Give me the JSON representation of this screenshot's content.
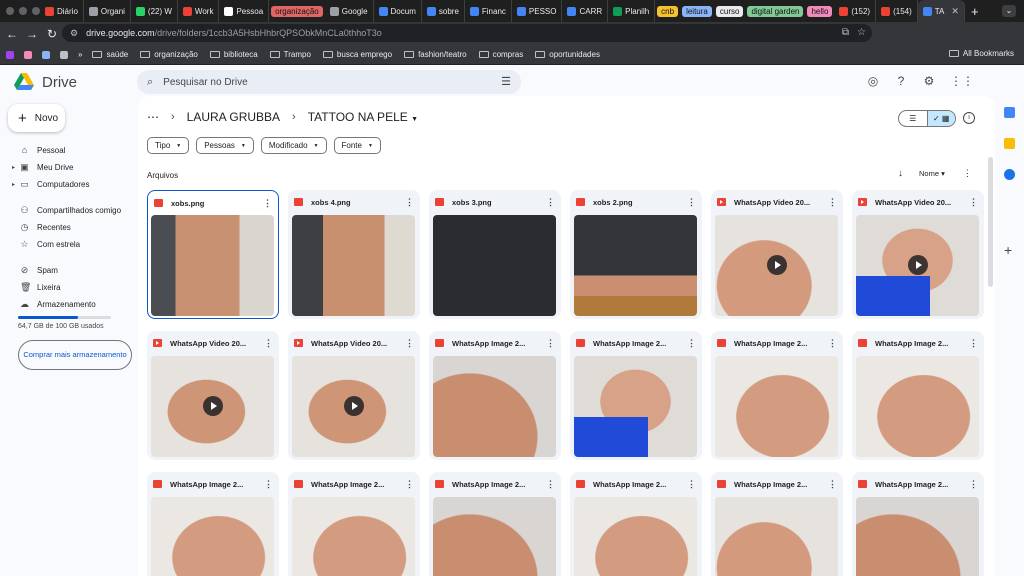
{
  "browser": {
    "tabs": [
      {
        "label": "Diário",
        "color": "#ea4335"
      },
      {
        "label": "Organi",
        "color": "#9aa0a6"
      },
      {
        "label": "(22) W",
        "color": "#25d366"
      },
      {
        "label": "Work",
        "color": "#ea4335"
      },
      {
        "label": "Pessoa",
        "color": "#ffffff"
      },
      {
        "label": "organização",
        "color": "#e06666",
        "pill": true
      },
      {
        "label": "Google",
        "color": "#9aa0a6"
      },
      {
        "label": "Docum",
        "color": "#4285f4"
      },
      {
        "label": "sobre",
        "color": "#4285f4"
      },
      {
        "label": "Financ",
        "color": "#4285f4"
      },
      {
        "label": "PESSO",
        "color": "#4285f4"
      },
      {
        "label": "CARR",
        "color": "#4285f4"
      },
      {
        "label": "Planilh",
        "color": "#0f9d58"
      },
      {
        "label": "cnb",
        "color": "#f4c430",
        "pill": true
      },
      {
        "label": "leitura",
        "color": "#8ab4f8",
        "pill": true
      },
      {
        "label": "curso",
        "color": "#e8eaed",
        "pill": true
      },
      {
        "label": "digital garden",
        "color": "#81c995",
        "pill": true
      },
      {
        "label": "hello",
        "color": "#f28bba",
        "pill": true
      },
      {
        "label": "(152)",
        "color": "#ea4335"
      },
      {
        "label": "(154)",
        "color": "#ea4335"
      },
      {
        "label": "TA",
        "color": "#4285f4",
        "active": true
      }
    ],
    "url_host": "drive.google.com",
    "url_path": "/drive/folders/1ccb3A5HsbHhbrQPSObkMnCLa0thhoT3o",
    "bookmarks": [
      "saúde",
      "organização",
      "biblioteca",
      "Trampo",
      "busca emprego",
      "fashion/teatro",
      "compras",
      "oportunidades"
    ],
    "all_bookmarks": "All Bookmarks"
  },
  "drive": {
    "app_name": "Drive",
    "search_placeholder": "Pesquisar no Drive",
    "new_label": "Novo",
    "nav": [
      {
        "label": "Pessoal",
        "icon": "home-icon"
      },
      {
        "label": "Meu Drive",
        "icon": "drive-icon",
        "caret": true
      },
      {
        "label": "Computadores",
        "icon": "computer-icon",
        "caret": true
      },
      {
        "label": "Compartilhados comigo",
        "icon": "people-icon"
      },
      {
        "label": "Recentes",
        "icon": "clock-icon"
      },
      {
        "label": "Com estrela",
        "icon": "star-icon"
      },
      {
        "label": "Spam",
        "icon": "spam-icon"
      },
      {
        "label": "Lixeira",
        "icon": "trash-icon"
      },
      {
        "label": "Armazenamento",
        "icon": "cloud-icon"
      }
    ],
    "storage_text": "64,7 GB de 100 GB usados",
    "storage_fraction": 0.647,
    "buy_storage": "Comprar mais armazenamento",
    "breadcrumb_parent": "LAURA GRUBBA",
    "breadcrumb_current": "TATTOO NA PELE",
    "filters": [
      "Tipo",
      "Pessoas",
      "Modificado",
      "Fonte"
    ],
    "section_label": "Arquivos",
    "sort_label": "Nome",
    "files": [
      {
        "name": "xobs.png",
        "kind": "image",
        "thumb": "t-leg1",
        "selected": true
      },
      {
        "name": "xobs 4.png",
        "kind": "image",
        "thumb": "t-leg2"
      },
      {
        "name": "xobs 3.png",
        "kind": "image",
        "thumb": "t-leg3"
      },
      {
        "name": "xobs 2.png",
        "kind": "image",
        "thumb": "t-leg4"
      },
      {
        "name": "WhatsApp Video 20...",
        "kind": "video",
        "thumb": "t-sh1"
      },
      {
        "name": "WhatsApp Video 20...",
        "kind": "video",
        "thumb": "t-shb",
        "strap": true
      },
      {
        "name": "WhatsApp Video 20...",
        "kind": "video",
        "thumb": "t-sh2"
      },
      {
        "name": "WhatsApp Video 20...",
        "kind": "video",
        "thumb": "t-sh2"
      },
      {
        "name": "WhatsApp Image 2...",
        "kind": "image",
        "thumb": "t-sh3"
      },
      {
        "name": "WhatsApp Image 2...",
        "kind": "image",
        "thumb": "t-shb",
        "strap": true
      },
      {
        "name": "WhatsApp Image 2...",
        "kind": "image",
        "thumb": "t-sh4"
      },
      {
        "name": "WhatsApp Image 2...",
        "kind": "image",
        "thumb": "t-sh4"
      },
      {
        "name": "WhatsApp Image 2...",
        "kind": "image",
        "thumb": "t-sh4"
      },
      {
        "name": "WhatsApp Image 2...",
        "kind": "image",
        "thumb": "t-sh4"
      },
      {
        "name": "WhatsApp Image 2...",
        "kind": "image",
        "thumb": "t-sh3"
      },
      {
        "name": "WhatsApp Image 2...",
        "kind": "image",
        "thumb": "t-sh4"
      },
      {
        "name": "WhatsApp Image 2...",
        "kind": "image",
        "thumb": "t-sh1"
      },
      {
        "name": "WhatsApp Image 2...",
        "kind": "image",
        "thumb": "t-sh3"
      }
    ]
  }
}
